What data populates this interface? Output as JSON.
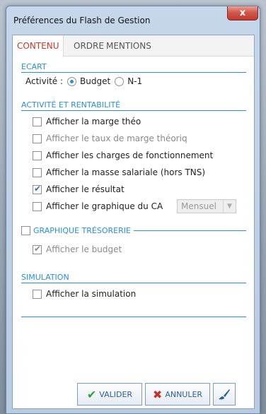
{
  "window": {
    "title": "Préférences du Flash de Gestion",
    "close_glyph": "x"
  },
  "tabs": [
    {
      "label": "CONTENU",
      "active": true
    },
    {
      "label": "ORDRE",
      "active": false
    },
    {
      "label": "MENTIONS",
      "active": false
    }
  ],
  "ecart": {
    "title": "ECART",
    "activite_label": "Activité :",
    "options": [
      {
        "label": "Budget",
        "selected": true
      },
      {
        "label": "N-1",
        "selected": false
      }
    ]
  },
  "activite": {
    "title": "ACTIVITÉ ET RENTABILITÉ",
    "items": [
      {
        "label": "Afficher la marge théo",
        "checked": false,
        "enabled": true
      },
      {
        "label": "Afficher le taux de marge théoriq",
        "checked": false,
        "enabled": false
      },
      {
        "label": "Afficher les charges de fonctionnement",
        "checked": false,
        "enabled": true
      },
      {
        "label": "Afficher la masse salariale (hors TNS)",
        "checked": false,
        "enabled": true
      },
      {
        "label": "Afficher le résultat",
        "checked": true,
        "enabled": true
      },
      {
        "label": "Afficher le graphique du CA",
        "checked": false,
        "enabled": true
      }
    ],
    "ca_period": {
      "value": "Mensuel"
    }
  },
  "tresorerie": {
    "title": "GRAPHIQUE TRÉSORERIE",
    "checked": false,
    "items": [
      {
        "label": "Afficher le budget",
        "checked": true,
        "enabled": false
      }
    ]
  },
  "simulation": {
    "title": "SIMULATION",
    "items": [
      {
        "label": "Afficher la simulation",
        "checked": false,
        "enabled": true
      }
    ]
  },
  "buttons": {
    "valider": "VALIDER",
    "annuler": "ANNULER"
  },
  "icons": {
    "valider": "checkmark-icon",
    "annuler": "cross-icon",
    "paint": "brush-icon"
  },
  "colors": {
    "accent": "#2b8fd4",
    "active_tab": "#d0352a",
    "valider_icon": "#2f9e3c",
    "annuler_icon": "#c8302a"
  }
}
